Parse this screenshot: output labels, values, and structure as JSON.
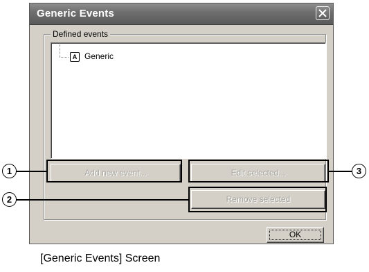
{
  "dialog": {
    "title": "Generic Events",
    "group_label": "Defined events",
    "tree": {
      "nodes": [
        {
          "icon_letter": "A",
          "label": "Generic"
        }
      ]
    },
    "buttons": {
      "add_label": "Add new event...",
      "edit_label": "Edit selected...",
      "remove_label": "Remove selected",
      "ok_label": "OK"
    }
  },
  "callouts": [
    "1",
    "2",
    "3"
  ],
  "caption": "[Generic Events] Screen",
  "icons": {
    "close": "close-icon"
  }
}
